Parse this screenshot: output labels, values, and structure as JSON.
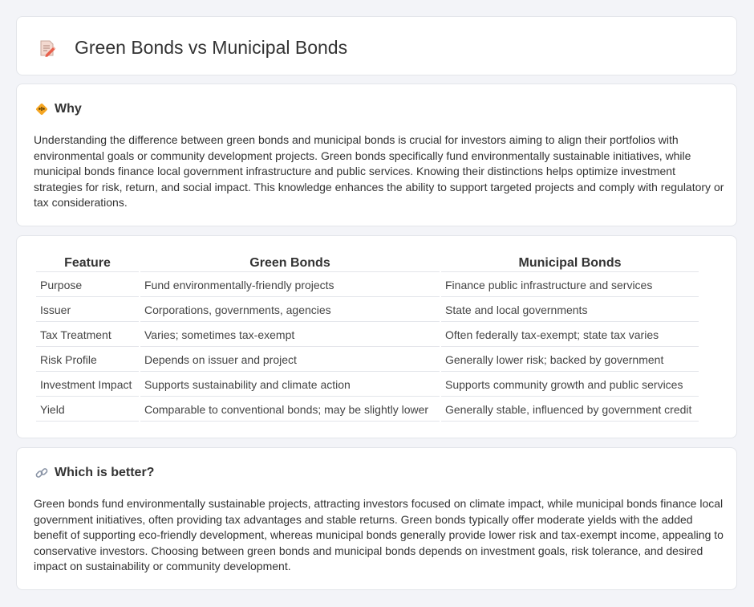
{
  "header": {
    "title": "Green Bonds vs Municipal Bonds",
    "icon": "document-pencil-icon"
  },
  "why": {
    "heading": "Why",
    "icon": "diamond-warning-icon",
    "text": "Understanding the difference between green bonds and municipal bonds is crucial for investors aiming to align their portfolios with environmental goals or community development projects. Green bonds specifically fund environmentally sustainable initiatives, while municipal bonds finance local government infrastructure and public services. Knowing their distinctions helps optimize investment strategies for risk, return, and social impact. This knowledge enhances the ability to support targeted projects and comply with regulatory or tax considerations."
  },
  "table": {
    "headers": [
      "Feature",
      "Green Bonds",
      "Municipal Bonds"
    ],
    "rows": [
      [
        "Purpose",
        "Fund environmentally-friendly projects",
        "Finance public infrastructure and services"
      ],
      [
        "Issuer",
        "Corporations, governments, agencies",
        "State and local governments"
      ],
      [
        "Tax Treatment",
        "Varies; sometimes tax-exempt",
        "Often federally tax-exempt; state tax varies"
      ],
      [
        "Risk Profile",
        "Depends on issuer and project",
        "Generally lower risk; backed by government"
      ],
      [
        "Investment Impact",
        "Supports sustainability and climate action",
        "Supports community growth and public services"
      ],
      [
        "Yield",
        "Comparable to conventional bonds; may be slightly lower",
        "Generally stable, influenced by government credit"
      ]
    ]
  },
  "better": {
    "heading": "Which is better?",
    "icon": "link-icon",
    "text": "Green bonds fund environmentally sustainable projects, attracting investors focused on climate impact, while municipal bonds finance local government initiatives, often providing tax advantages and stable returns. Green bonds typically offer moderate yields with the added benefit of supporting eco-friendly development, whereas municipal bonds generally provide lower risk and tax-exempt income, appealing to conservative investors. Choosing between green bonds and municipal bonds depends on investment goals, risk tolerance, and desired impact on sustainability or community development."
  },
  "colors": {
    "background": "#f3f4f8",
    "card": "#ffffff",
    "border": "#e3e5ea",
    "text": "#333333",
    "accent": "#f5a623"
  }
}
